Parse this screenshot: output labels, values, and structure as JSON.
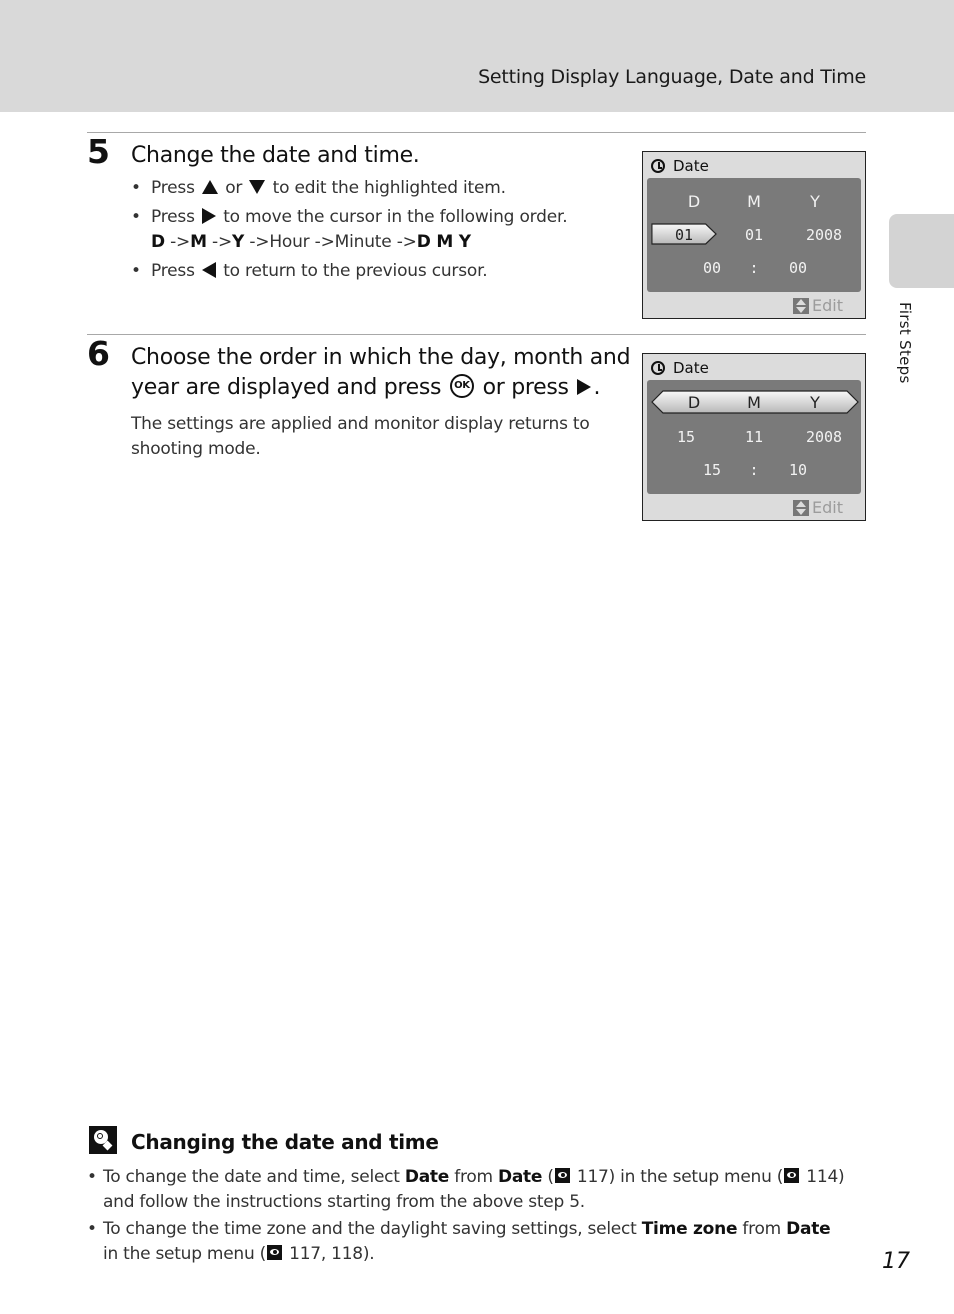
{
  "header": {
    "title": "Setting Display Language, Date and Time"
  },
  "side_tab": {
    "label": "First Steps"
  },
  "step5": {
    "number": "5",
    "title": "Change the date and time.",
    "bullets": {
      "b1": {
        "pre": "Press",
        "mid": "or",
        "post": "to edit the highlighted item."
      },
      "b2": {
        "pre": "Press",
        "post": "to move the cursor in the following order.",
        "seq_d": "D",
        "arrow1": " ->",
        "seq_m": "M",
        "arrow2": " ->",
        "seq_y": "Y",
        "rest": " ->Hour ->Minute ->",
        "seq_dmy": "D M Y"
      },
      "b3": {
        "pre": "Press",
        "post": "to return to the previous cursor."
      }
    },
    "screen": {
      "title": "Date",
      "headers": [
        "D",
        "M",
        "Y"
      ],
      "date_values": [
        "01",
        "01",
        "2008"
      ],
      "time_values": [
        "00",
        ":",
        "00"
      ],
      "selected": "day",
      "edit_label": "Edit"
    }
  },
  "step6": {
    "number": "6",
    "title_line1": "Choose the order in which the day, month and",
    "title_line2_pre": "year are displayed and press",
    "title_line2_mid": "or press",
    "ok_label": "OK",
    "body": "The settings are applied and monitor display returns to shooting mode.",
    "screen": {
      "title": "Date",
      "headers": [
        "D",
        "M",
        "Y"
      ],
      "date_values": [
        "15",
        "11",
        "2008"
      ],
      "time_values": [
        "15",
        ":",
        "10"
      ],
      "selected": "order",
      "edit_label": "Edit"
    }
  },
  "tip": {
    "title": "Changing the date and time",
    "items": {
      "i1": {
        "t1": "To change the date and time, select ",
        "b1": "Date",
        "t2": " from ",
        "b2": "Date",
        "t3": " (",
        "r1": " 117) in the setup menu (",
        "r2": " 114) and follow the instructions starting from the above step 5."
      },
      "i2": {
        "t1": "To change the time zone and the daylight saving settings, select ",
        "b1": "Time zone",
        "t2": " from ",
        "b2": "Date",
        "t3": " in the setup menu (",
        "r1": " 117, 118)."
      }
    }
  },
  "page_number": "17"
}
